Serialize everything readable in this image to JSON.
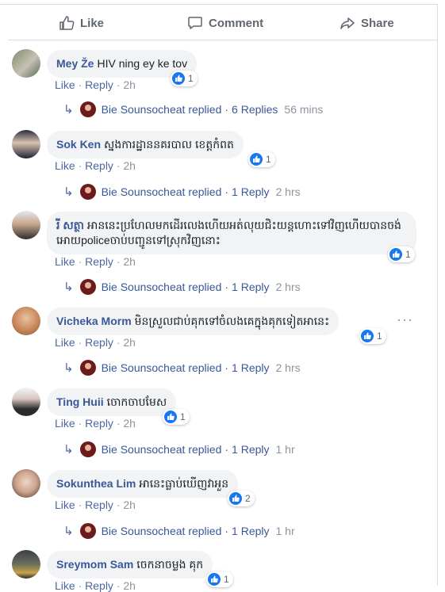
{
  "actions": {
    "like": "Like",
    "comment": "Comment",
    "share": "Share"
  },
  "colors": {
    "link": "#385898",
    "meta": "#8d949e",
    "bubble": "#f2f3f5",
    "like_badge": "#1877f2"
  },
  "comments": [
    {
      "author": "Mey Že",
      "text": "HIV ning ey ke tov",
      "reactions": "1",
      "like": "Like",
      "reply": "Reply",
      "time": "2h",
      "reply_summary": {
        "name": "Bie Sounsocheat replied",
        "sep": "·",
        "count": "6 Replies",
        "time": "56 mins"
      }
    },
    {
      "author": "Sok Ken",
      "text": "ស្នងការដ្ឋាននគរបាល ខេត្តកំពត",
      "reactions": "1",
      "like": "Like",
      "reply": "Reply",
      "time": "2h",
      "reply_summary": {
        "name": "Bie Sounsocheat replied",
        "sep": "·",
        "count": "1 Reply",
        "time": "2 hrs"
      }
    },
    {
      "author": "រី សត្ថា",
      "text": "អាននេះប្រហែលមកដើរលេងហើយអត់លុយជិះយន្តហោះទៅវិញហើយបានចង់អោយpoliceចាប់បញ្ជូនទៅស្រុកវិញនោះ",
      "reactions": "1",
      "like": "Like",
      "reply": "Reply",
      "time": "2h",
      "reply_summary": {
        "name": "Bie Sounsocheat replied",
        "sep": "·",
        "count": "1 Reply",
        "time": "2 hrs"
      }
    },
    {
      "author": "Vicheka Morm",
      "text": "មិនស្រួលជាប់គុកទៅចំលងគេក្នុងគុកទៀតអានេះ",
      "reactions": "1",
      "like": "Like",
      "reply": "Reply",
      "time": "2h",
      "reply_summary": {
        "name": "Bie Sounsocheat replied",
        "sep": "·",
        "count": "1 Reply",
        "time": "2 hrs"
      }
    },
    {
      "author": "Ting Huii",
      "text": "ចោកចាបមែស",
      "reactions": "1",
      "like": "Like",
      "reply": "Reply",
      "time": "2h",
      "reply_summary": {
        "name": "Bie Sounsocheat replied",
        "sep": "·",
        "count": "1 Reply",
        "time": "1 hr"
      }
    },
    {
      "author": "Sokunthea Lim",
      "text": "អានេះធ្លាប់ឃើញវាអួន",
      "reactions": "2",
      "like": "Like",
      "reply": "Reply",
      "time": "2h",
      "reply_summary": {
        "name": "Bie Sounsocheat replied",
        "sep": "·",
        "count": "1 Reply",
        "time": "1 hr"
      }
    },
    {
      "author": "Sreymom Sam",
      "text": "ចេកនាចម្លង គុក",
      "reactions": "1",
      "like": "Like",
      "reply": "Reply",
      "time": "2h"
    }
  ]
}
